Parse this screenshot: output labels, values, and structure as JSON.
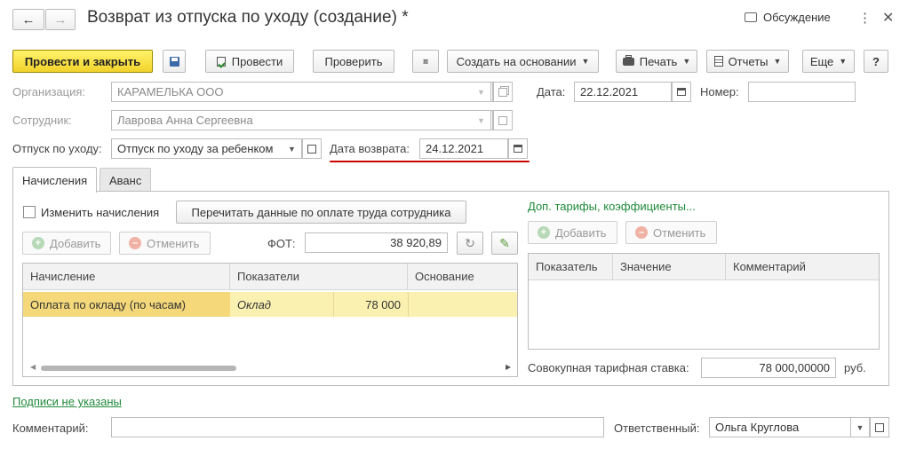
{
  "window": {
    "title": "Возврат из отпуска по уходу (создание) *",
    "discussion": "Обсуждение",
    "back_icon": "arrow-left-icon",
    "forward_icon": "arrow-right-icon"
  },
  "toolbar": {
    "post_close": "Провести и закрыть",
    "post": "Провести",
    "check": "Проверить",
    "create_based": "Создать на основании",
    "print": "Печать",
    "reports": "Отчеты",
    "more": "Еще",
    "help": "?"
  },
  "header": {
    "org_label": "Организация:",
    "org_value": "КАРАМЕЛЬКА ООО",
    "date_label": "Дата:",
    "date_value": "22.12.2021",
    "number_label": "Номер:",
    "number_value": "",
    "employee_label": "Сотрудник:",
    "employee_value": "Лаврова Анна Сергеевна",
    "leave_label": "Отпуск по уходу:",
    "leave_value": "Отпуск по уходу за ребенком",
    "return_date_label": "Дата возврата:",
    "return_date_value": "24.12.2021"
  },
  "tabs": [
    {
      "label": "Начисления",
      "active": true
    },
    {
      "label": "Аванс",
      "active": false
    }
  ],
  "accruals": {
    "change_label": "Изменить начисления",
    "change_checked": false,
    "reread_button": "Перечитать данные по оплате труда сотрудника",
    "add_button": "Добавить",
    "cancel_button": "Отменить",
    "fot_label": "ФОТ:",
    "fot_value": "38 920,89",
    "columns": [
      "Начисление",
      "Показатели",
      "Основание"
    ],
    "rows": [
      {
        "accrual": "Оплата по окладу (по часам)",
        "indicator": "Оклад",
        "value": "78 000",
        "basis": ""
      }
    ]
  },
  "tariffs": {
    "link": "Доп. тарифы, коэффициенты...",
    "add_button": "Добавить",
    "cancel_button": "Отменить",
    "columns": [
      "Показатель",
      "Значение",
      "Комментарий"
    ],
    "total_label": "Совокупная тарифная ставка:",
    "total_value": "78 000,00000",
    "currency": "руб."
  },
  "footer": {
    "signatures_link": "Подписи не указаны",
    "comment_label": "Комментарий:",
    "comment_value": "",
    "responsible_label": "Ответственный:",
    "responsible_value": "Ольга Круглова"
  },
  "colors": {
    "primary_button": "#f2d22a",
    "link_green": "#1f8a3a",
    "row_highlight": "#faf0b0",
    "annotation_red": "#cc0000"
  }
}
